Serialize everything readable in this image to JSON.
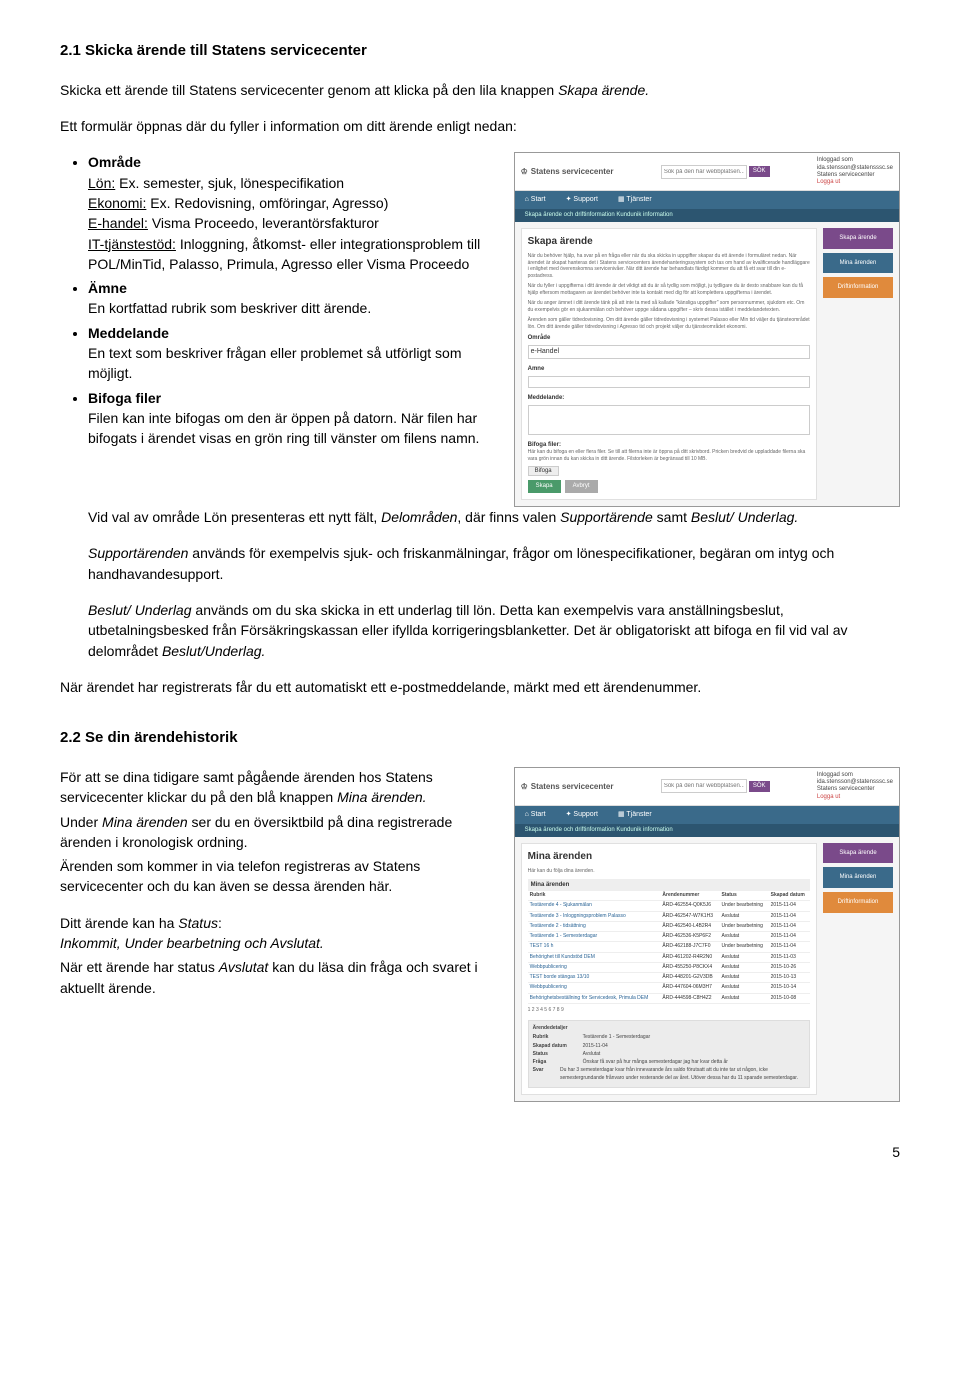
{
  "section21": {
    "heading": "2.1 Skicka ärende till Statens servicecenter",
    "p1_a": "Skicka ett ärende till Statens servicecenter genom att klicka på den lila knappen ",
    "p1_em": "Skapa ärende.",
    "p2": "Ett formulär öppnas där du fyller i information om ditt ärende enligt nedan:",
    "bullets": {
      "omrade": {
        "title": "Område",
        "lon_label": "Lön:",
        "lon_text": " Ex. semester, sjuk, lönespecifikation",
        "eko_label": "Ekonomi:",
        "eko_text": " Ex. Redovisning, omföringar, Agresso)",
        "ehandel_label": "E-handel:",
        "ehandel_text": " Visma Proceedo, leverantörsfakturor",
        "it_label": "IT-tjänstestöd:",
        "it_text": " Inloggning, åtkomst- eller integrationsproblem till POL/MinTid, Palasso, Primula, Agresso eller Visma Proceedo"
      },
      "amne": {
        "title": "Ämne",
        "text": "En kortfattad rubrik som beskriver ditt ärende."
      },
      "meddelande": {
        "title": "Meddelande",
        "text": "En text som beskriver frågan eller problemet så utförligt som möjligt."
      },
      "bifoga": {
        "title": "Bifoga filer",
        "text": "Filen kan inte bifogas om den är öppen på datorn. När filen har bifogats i ärendet visas en grön ring till vänster om filens namn."
      }
    },
    "after1_a": "Vid val av område Lön presenteras ett nytt fält, ",
    "after1_em1": "Delområden",
    "after1_b": ", där finns valen ",
    "after1_em2": "Supportärende",
    "after1_c": " samt ",
    "after1_em3": "Beslut/ Underlag.",
    "after2_em": "Supportärenden",
    "after2_text": " används för exempelvis sjuk- och friskanmälningar, frågor om lönespecifikationer, begäran om intyg och handhavandesupport.",
    "after3_em": "Beslut/ Underlag",
    "after3_text_a": " används om du ska skicka in ett underlag till lön. Detta kan exempelvis vara anställningsbeslut, utbetalningsbesked från Försäkringskassan eller ifyllda korrigeringsblanketter. Det är obligatoriskt att bifoga en fil vid val av delområdet ",
    "after3_em2": "Beslut/Underlag.",
    "after4": "När ärendet har registrerats får du ett automatiskt ett e-postmeddelande, märkt med ett ärendenummer."
  },
  "section22": {
    "heading": "2.2 Se din ärendehistorik",
    "p1_a": "För att se dina tidigare samt pågående ärenden hos Statens servicecenter klickar du på den blå knappen ",
    "p1_em": "Mina ärenden.",
    "p2_a": "Under ",
    "p2_em": "Mina ärenden",
    "p2_b": " ser du en översiktbild på dina registrerade ärenden i kronologisk ordning.",
    "p3": "Ärenden som kommer in via telefon registreras av Statens servicecenter och du kan även se dessa ärenden här.",
    "p4_a": "Ditt ärende kan ha ",
    "p4_em1": "Status",
    "p4_b": ":",
    "p4_em2": "Inkommit, Under bearbetning och Avslutat.",
    "p5_a": "När ett ärende har status ",
    "p5_em": "Avslutat",
    "p5_b": " kan du läsa din fråga och svaret i aktuellt ärende."
  },
  "shot1": {
    "logo": "Statens servicecenter",
    "search_ph": "Sök på den här webbplatsen...",
    "sok": "SÖK",
    "user_label": "Inloggad som",
    "user_name": "ida.stensson@statensssc.se",
    "user_org": "Statens servicecenter",
    "logout": "Logga ut",
    "nav_start": "Start",
    "nav_support": "Support",
    "nav_tjanster": "Tjänster",
    "subnav": "Skapa ärende och driftinformation    Kundunik information",
    "title": "Skapa ärende",
    "desc1": "När du behöver hjälp, ha svar på en fråga eller när du ska skicka in uppgifter skapar du ett ärende i formuläret nedan. När ärendet är skapat hanteras det i Statens servicecenters ärendehanteringssystem och tas om hand av kvalificerade handläggare i enlighet med överenskomna servicenivåer. När ditt ärende har behandlats färdigt kommer du att få ett svar till din e-postadress.",
    "desc2": "När du fyller i uppgifterna i ditt ärende är det viktigt att du är så tydlig som möjligt, ju tydligare du är desto snabbare kan du få hjälp eftersom mottagaren av ärendet behöver inte ta kontakt med dig för att komplettera uppgifterna i ärendet.",
    "desc3": "När du anger ämnet i ditt ärende tänk på att inte ta med så kallade \"känsliga uppgifter\" som personnummer, sjukdom etc. Om du exempelvis gör en sjukanmälan och behöver uppge sådana uppgifter – skriv dessa istället i meddelandetexten.",
    "desc4": "Ärenden som gäller tidredovisning. Om ditt ärende gäller tidredovisning i systemet Palasso eller Min tid väljer du tjänsteområdet lön. Om ditt ärende gäller tidredovisning i Agresso tid och projekt väljer du tjänsteområdet ekonomi.",
    "lbl_omrade": "Område",
    "val_omrade": "e-Handel",
    "lbl_amne": "Amne",
    "lbl_medd": "Meddelande:",
    "lbl_bifoga": "Bifoga filer:",
    "bifoga_info": "Här kan du bifoga en eller flera filer. Se till att filerna inte är öppna på ditt skrivbord. Pricken bredvid de uppladdade filerna ska vara grön innan du kan skicka in ditt ärende. Filstorleken är begränsad till 10 MB.",
    "btn_bifoga": "Bifoga",
    "btn_skapa": "Skapa",
    "btn_avbryt": "Avbryt",
    "side_skapa": "Skapa ärende",
    "side_mina": "Mina ärenden",
    "side_drift": "Driftinformation"
  },
  "shot2": {
    "title": "Mina ärenden",
    "sub": "Här kan du följa dina ärenden.",
    "th_rubrik": "Rubrik",
    "th_nummer": "Ärendenummer",
    "th_status": "Status",
    "th_datum": "Skapad datum",
    "rows": [
      {
        "r": "Testärende 4 - Sjukanmälan",
        "n": "ÅRD-462554-Q0K5J6",
        "s": "Under bearbetning",
        "d": "2015-11-04"
      },
      {
        "r": "Testärende 3 - Inloggningsproblem Palasso",
        "n": "ÅRD-462547-W7K1H3",
        "s": "Avslutat",
        "d": "2015-11-04"
      },
      {
        "r": "Testärende 2 - tidsättning",
        "n": "ÅRD-462540-L4B2R4",
        "s": "Under bearbetning",
        "d": "2015-11-04"
      },
      {
        "r": "Testärende 1 - Semesterdagar",
        "n": "ÅRD-462536-K5P6F2",
        "s": "Avslutat",
        "d": "2015-11-04"
      },
      {
        "r": "TEST 16 h",
        "n": "ÅRD-462188-J7C7F0",
        "s": "Under bearbetning",
        "d": "2015-11-04"
      },
      {
        "r": "Behörighet till Kundstöd DEM",
        "n": "ÅRD-461202-R4R2N0",
        "s": "Avslutat",
        "d": "2015-11-03"
      },
      {
        "r": "Webbpublicering",
        "n": "ÅRD-455250-P8CKX4",
        "s": "Avslutat",
        "d": "2015-10-26"
      },
      {
        "r": "TEST borde stängas 13/10",
        "n": "ÅRD-448201-G2V3DB",
        "s": "Avslutat",
        "d": "2015-10-13"
      },
      {
        "r": "Webbpublicering",
        "n": "ÅRD-447604-06M3H7",
        "s": "Avslutat",
        "d": "2015-10-14"
      },
      {
        "r": "Behörighetsbeställning för Servicedesk, Primula DEM",
        "n": "ÅRD-444598-C8H4Z2",
        "s": "Avslutat",
        "d": "2015-10-08"
      }
    ],
    "pager": "1 2 3 4 5 6 7 8 9",
    "detail_title": "Ärendedetaljer",
    "d_rubrik_l": "Rubrik",
    "d_rubrik_v": "Testärende 1 - Semesterdagar",
    "d_datum_l": "Skapad datum",
    "d_datum_v": "2015-11-04",
    "d_status_l": "Status",
    "d_status_v": "Avslutat",
    "d_fraga_l": "Fråga",
    "d_fraga_v": "Önskar få svar på hur många semesterdagar jag har kvar detta år",
    "d_svar_l": "Svar",
    "d_svar_v": "Du har 3 semesterdagar kvar från innevarande års saldo förutsatt att du inte tar ut någon, icke semestergrundande frånvaro under resterande del av året. Utöver dessa har du 11 sparade semesterdagar."
  },
  "pagefoot": "5"
}
